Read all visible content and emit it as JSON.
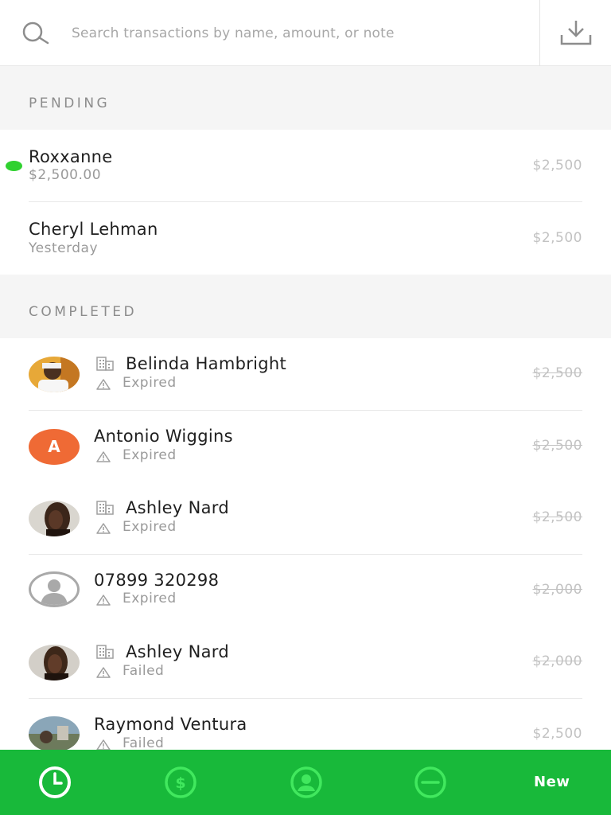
{
  "search": {
    "placeholder": "Search transactions by name, amount, or note"
  },
  "sections": {
    "pending": "PENDING",
    "completed": "COMPLETED"
  },
  "pending": [
    {
      "name": "Roxxanne",
      "sub": "$2,500.00",
      "amount": "$2,500",
      "indicator": "green-dot"
    },
    {
      "name": "Cheryl Lehman",
      "sub": "Yesterday",
      "amount": "$2,500"
    }
  ],
  "completed": [
    {
      "name": "Belinda Hambright",
      "status": "Expired",
      "amount": "$2,500",
      "avatar": "photo",
      "business": true
    },
    {
      "name": "Antonio Wiggins",
      "status": "Expired",
      "amount": "$2,500",
      "avatar": "initial",
      "initial": "A",
      "business": false
    },
    {
      "name": "Ashley Nard",
      "status": "Expired",
      "amount": "$2,500",
      "avatar": "photo",
      "business": true
    },
    {
      "name": "07899 320298",
      "status": "Expired",
      "amount": "$2,000",
      "avatar": "default",
      "business": false
    },
    {
      "name": "Ashley Nard",
      "status": "Failed",
      "amount": "$2,000",
      "avatar": "photo",
      "business": true
    },
    {
      "name": "Raymond Ventura",
      "status": "Failed",
      "amount": "$2,500",
      "avatar": "photo",
      "business": false
    }
  ],
  "tabbar": {
    "tabs": [
      "clock-icon",
      "dollar-icon",
      "profile-icon",
      "minus-icon"
    ],
    "new_label": "New"
  },
  "colors": {
    "brand_green": "#18b93a",
    "pending_dot": "#2fd12f",
    "initial_avatar": "#ef6a35"
  }
}
